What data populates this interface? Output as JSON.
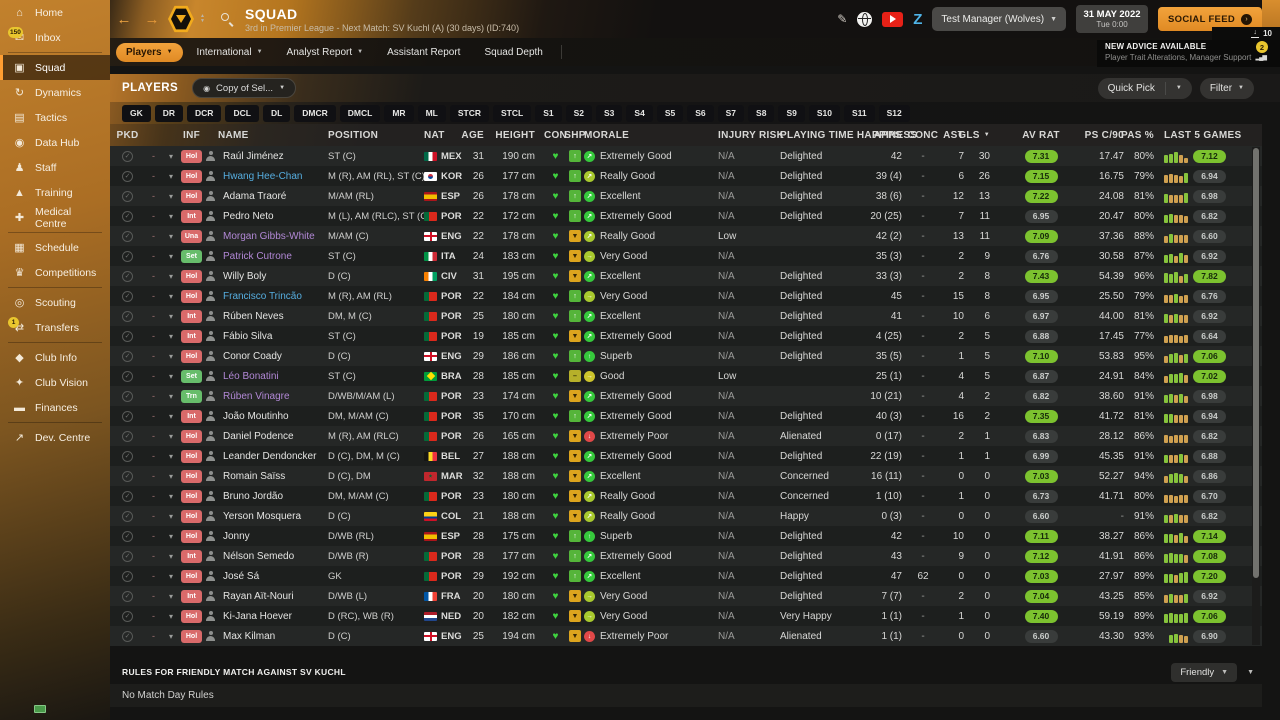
{
  "sidebar": {
    "items": [
      {
        "label": "Home",
        "icon": "home-icon",
        "glyph": "⌂"
      },
      {
        "label": "Inbox",
        "icon": "inbox-icon",
        "glyph": "✉",
        "badge": "150",
        "divider_after": true
      },
      {
        "label": "Squad",
        "icon": "squad-icon",
        "glyph": "▣",
        "active": true
      },
      {
        "label": "Dynamics",
        "icon": "dynamics-icon",
        "glyph": "↻"
      },
      {
        "label": "Tactics",
        "icon": "tactics-icon",
        "glyph": "▤"
      },
      {
        "label": "Data Hub",
        "icon": "data-hub-icon",
        "glyph": "◉"
      },
      {
        "label": "Staff",
        "icon": "staff-icon",
        "glyph": "♟"
      },
      {
        "label": "Training",
        "icon": "training-icon",
        "glyph": "▲"
      },
      {
        "label": "Medical Centre",
        "icon": "medical-centre-icon",
        "glyph": "✚",
        "divider_after": true
      },
      {
        "label": "Schedule",
        "icon": "schedule-icon",
        "glyph": "▦"
      },
      {
        "label": "Competitions",
        "icon": "competitions-icon",
        "glyph": "♛",
        "divider_after": true
      },
      {
        "label": "Scouting",
        "icon": "scouting-icon",
        "glyph": "◎"
      },
      {
        "label": "Transfers",
        "icon": "transfers-icon",
        "glyph": "⇄",
        "badge": "1",
        "divider_after": true
      },
      {
        "label": "Club Info",
        "icon": "club-info-icon",
        "glyph": "◆"
      },
      {
        "label": "Club Vision",
        "icon": "club-vision-icon",
        "glyph": "✦"
      },
      {
        "label": "Finances",
        "icon": "finances-icon",
        "glyph": "▬",
        "divider_after": true
      },
      {
        "label": "Dev. Centre",
        "icon": "dev-centre-icon",
        "glyph": "↗"
      }
    ]
  },
  "topbar": {
    "title": "SQUAD",
    "subtitle": "3rd in Premier League - Next Match: SV Kuchl (A) (30 days) (ID:740)",
    "manager": "Test Manager (Wolves)",
    "date_line1": "31 MAY 2022",
    "date_line2": "Tue 0:00",
    "social_feed": "SOCIAL FEED",
    "downloads": "10"
  },
  "advice": {
    "title": "NEW ADVICE AVAILABLE",
    "subtitle": "Player Trait Alterations, Manager Support",
    "badge": "2"
  },
  "nav": {
    "tabs": [
      {
        "label": "Players",
        "active": true,
        "caret": true
      },
      {
        "label": "International",
        "caret": true
      },
      {
        "label": "Analyst Report",
        "caret": true
      },
      {
        "label": "Assistant Report"
      },
      {
        "label": "Squad Depth"
      }
    ]
  },
  "toolbar": {
    "title": "PLAYERS",
    "view": "Copy of Sel...",
    "quick_pick": "Quick Pick",
    "filter": "Filter"
  },
  "filters": {
    "positions": [
      "GK",
      "DR",
      "DCR",
      "DCL",
      "DL",
      "DMCR",
      "DMCL",
      "MR",
      "ML",
      "STCR",
      "STCL",
      "S1",
      "S2",
      "S3",
      "S4",
      "S5",
      "S6",
      "S7",
      "S8",
      "S9",
      "S10",
      "S11",
      "S12"
    ]
  },
  "table": {
    "columns": [
      "PKD",
      "",
      "",
      "INF",
      "",
      "NAME",
      "POSITION",
      "NAT",
      "AGE",
      "HEIGHT",
      "CON",
      "SHP",
      "MORALE",
      "INJURY RISK",
      "PLAYING TIME HAPPINESS",
      "APPS",
      "CONC",
      "AST",
      "GLS",
      "AV RAT",
      "PS C/90",
      "PAS %",
      "LAST 5 GAMES"
    ],
    "sort_column": "GLS",
    "rows": [
      {
        "inf": "Hol",
        "inf_color": "red",
        "name": "Raúl Jiménez",
        "name_color": "default",
        "pos": "ST (C)",
        "nat": "MEX",
        "age": "31",
        "height": "190 cm",
        "shp": "up",
        "morale": "Extremely Good",
        "injury": "N/A",
        "happiness": "Delighted",
        "apps": "42",
        "conc": "-",
        "ast": "7",
        "gls": "30",
        "av_rat": "7.31",
        "av_good": true,
        "ps_c90": "17.47",
        "pas": "80%",
        "last5_bars": "g8 g9 g11 o8 o5",
        "last5_rat": "7.12",
        "last5_good": true
      },
      {
        "inf": "Hol",
        "inf_color": "red",
        "name": "Hwang Hee-Chan",
        "name_color": "blue",
        "pos": "M (R), AM (RL), ST (C)",
        "nat": "KOR",
        "age": "26",
        "height": "177 cm",
        "shp": "up",
        "morale": "Really Good",
        "injury": "N/A",
        "happiness": "Delighted",
        "apps": "39 (4)",
        "conc": "-",
        "ast": "6",
        "gls": "26",
        "av_rat": "7.15",
        "av_good": true,
        "ps_c90": "16.75",
        "pas": "79%",
        "last5_bars": "o8 o9 o8 o7 g10",
        "last5_rat": "6.94",
        "last5_good": false
      },
      {
        "inf": "Hol",
        "inf_color": "red",
        "name": "Adama Traoré",
        "name_color": "default",
        "pos": "M/AM (RL)",
        "nat": "ESP",
        "age": "26",
        "height": "178 cm",
        "shp": "up",
        "morale": "Excellent",
        "injury": "N/A",
        "happiness": "Delighted",
        "apps": "38 (6)",
        "conc": "-",
        "ast": "12",
        "gls": "13",
        "av_rat": "7.22",
        "av_good": true,
        "ps_c90": "24.08",
        "pas": "81%",
        "last5_bars": "g9 o8 o8 o8 g10",
        "last5_rat": "6.98",
        "last5_good": false
      },
      {
        "inf": "Int",
        "inf_color": "red",
        "name": "Pedro Neto",
        "name_color": "default",
        "pos": "M (L), AM (RLC), ST (C)",
        "nat": "POR",
        "age": "22",
        "height": "172 cm",
        "shp": "up",
        "morale": "Extremely Good",
        "injury": "N/A",
        "happiness": "Delighted",
        "apps": "20 (25)",
        "conc": "-",
        "ast": "7",
        "gls": "11",
        "av_rat": "6.95",
        "av_good": false,
        "ps_c90": "20.47",
        "pas": "80%",
        "last5_bars": "g8 g9 o8 o8 o7",
        "last5_rat": "6.82",
        "last5_good": false
      },
      {
        "inf": "Una",
        "inf_color": "red",
        "name": "Morgan Gibbs-White",
        "name_color": "purple",
        "pos": "M/AM (C)",
        "nat": "ENG",
        "age": "22",
        "height": "178 cm",
        "shp": "down",
        "morale": "Really Good",
        "injury": "Low",
        "happiness": "",
        "apps": "42 (2)",
        "conc": "-",
        "ast": "13",
        "gls": "11",
        "av_rat": "7.09",
        "av_good": true,
        "ps_c90": "37.36",
        "pas": "88%",
        "last5_bars": "o7 g9 o8 o8 o8",
        "last5_rat": "6.60",
        "last5_good": false
      },
      {
        "inf": "Set",
        "inf_color": "green",
        "name": "Patrick Cutrone",
        "name_color": "purple",
        "pos": "ST (C)",
        "nat": "ITA",
        "age": "24",
        "height": "183 cm",
        "shp": "down",
        "morale": "Very Good",
        "injury": "N/A",
        "happiness": "",
        "apps": "35 (3)",
        "conc": "-",
        "ast": "2",
        "gls": "9",
        "av_rat": "6.76",
        "av_good": false,
        "ps_c90": "30.58",
        "pas": "87%",
        "last5_bars": "g8 g9 o7 g10 o8",
        "last5_rat": "6.92",
        "last5_good": false
      },
      {
        "inf": "Hol",
        "inf_color": "red",
        "name": "Willy Boly",
        "name_color": "default",
        "pos": "D (C)",
        "nat": "CIV",
        "age": "31",
        "height": "195 cm",
        "shp": "down",
        "morale": "Excellent",
        "injury": "N/A",
        "happiness": "Delighted",
        "apps": "33 (3)",
        "conc": "-",
        "ast": "2",
        "gls": "8",
        "av_rat": "7.43",
        "av_good": true,
        "ps_c90": "54.39",
        "pas": "96%",
        "last5_bars": "g10 g9 g11 o7 g9",
        "last5_rat": "7.82",
        "last5_good": true
      },
      {
        "inf": "Hol",
        "inf_color": "red",
        "name": "Francisco Trincão",
        "name_color": "blue",
        "pos": "M (R), AM (RL)",
        "nat": "POR",
        "age": "22",
        "height": "184 cm",
        "shp": "up",
        "morale": "Very Good",
        "injury": "N/A",
        "happiness": "Delighted",
        "apps": "45",
        "conc": "-",
        "ast": "15",
        "gls": "8",
        "av_rat": "6.95",
        "av_good": false,
        "ps_c90": "25.50",
        "pas": "79%",
        "last5_bars": "o8 o8 g9 o7 o8",
        "last5_rat": "6.76",
        "last5_good": false
      },
      {
        "inf": "Int",
        "inf_color": "red",
        "name": "Rúben Neves",
        "name_color": "default",
        "pos": "DM, M (C)",
        "nat": "POR",
        "age": "25",
        "height": "180 cm",
        "shp": "up",
        "morale": "Excellent",
        "injury": "N/A",
        "happiness": "Delighted",
        "apps": "41",
        "conc": "-",
        "ast": "10",
        "gls": "6",
        "av_rat": "6.97",
        "av_good": false,
        "ps_c90": "44.00",
        "pas": "81%",
        "last5_bars": "g9 o8 g9 o8 o8",
        "last5_rat": "6.92",
        "last5_good": false
      },
      {
        "inf": "Int",
        "inf_color": "red",
        "name": "Fábio Silva",
        "name_color": "default",
        "pos": "ST (C)",
        "nat": "POR",
        "age": "19",
        "height": "185 cm",
        "shp": "down",
        "morale": "Extremely Good",
        "injury": "N/A",
        "happiness": "Delighted",
        "apps": "4 (25)",
        "conc": "-",
        "ast": "2",
        "gls": "5",
        "av_rat": "6.88",
        "av_good": false,
        "ps_c90": "17.45",
        "pas": "77%",
        "last5_bars": "o7 o8 o8 o7 o8",
        "last5_rat": "6.64",
        "last5_good": false
      },
      {
        "inf": "Hol",
        "inf_color": "red",
        "name": "Conor Coady",
        "name_color": "default",
        "pos": "D (C)",
        "nat": "ENG",
        "age": "29",
        "height": "186 cm",
        "shp": "up",
        "morale": "Superb",
        "injury": "N/A",
        "happiness": "Delighted",
        "apps": "35 (5)",
        "conc": "-",
        "ast": "1",
        "gls": "5",
        "av_rat": "7.10",
        "av_good": true,
        "ps_c90": "53.83",
        "pas": "95%",
        "last5_bars": "o7 g9 g10 o8 g9",
        "last5_rat": "7.06",
        "last5_good": true
      },
      {
        "inf": "Set",
        "inf_color": "green",
        "name": "Léo Bonatini",
        "name_color": "purple",
        "pos": "ST (C)",
        "nat": "BRA",
        "age": "28",
        "height": "185 cm",
        "shp": "flat",
        "morale": "Good",
        "injury": "Low",
        "happiness": "",
        "apps": "25 (1)",
        "conc": "-",
        "ast": "4",
        "gls": "5",
        "av_rat": "6.87",
        "av_good": false,
        "ps_c90": "24.91",
        "pas": "84%",
        "last5_bars": "o7 g9 g9 g10 o8",
        "last5_rat": "7.02",
        "last5_good": true
      },
      {
        "inf": "Trn",
        "inf_color": "green",
        "name": "Rúben Vinagre",
        "name_color": "purple",
        "pos": "D/WB/M/AM (L)",
        "nat": "POR",
        "age": "23",
        "height": "174 cm",
        "shp": "down",
        "morale": "Extremely Good",
        "injury": "N/A",
        "happiness": "",
        "apps": "10 (21)",
        "conc": "-",
        "ast": "4",
        "gls": "2",
        "av_rat": "6.82",
        "av_good": false,
        "ps_c90": "38.60",
        "pas": "91%",
        "last5_bars": "g8 g9 o8 g9 o7",
        "last5_rat": "6.98",
        "last5_good": false
      },
      {
        "inf": "Int",
        "inf_color": "red",
        "name": "João Moutinho",
        "name_color": "default",
        "pos": "DM, M/AM (C)",
        "nat": "POR",
        "age": "35",
        "height": "170 cm",
        "shp": "up",
        "morale": "Extremely Good",
        "injury": "N/A",
        "happiness": "Delighted",
        "apps": "40 (3)",
        "conc": "-",
        "ast": "16",
        "gls": "2",
        "av_rat": "7.35",
        "av_good": true,
        "ps_c90": "41.72",
        "pas": "81%",
        "last5_bars": "g9 g9 o8 o8 o8",
        "last5_rat": "6.94",
        "last5_good": false
      },
      {
        "inf": "Hol",
        "inf_color": "red",
        "name": "Daniel Podence",
        "name_color": "default",
        "pos": "M (R), AM (RLC)",
        "nat": "POR",
        "age": "26",
        "height": "165 cm",
        "shp": "down",
        "morale": "Extremely Poor",
        "injury": "N/A",
        "happiness": "Alienated",
        "apps": "0 (17)",
        "conc": "-",
        "ast": "2",
        "gls": "1",
        "av_rat": "6.83",
        "av_good": false,
        "ps_c90": "28.12",
        "pas": "86%",
        "last5_bars": "o8 o7 o8 o8 o8",
        "last5_rat": "6.82",
        "last5_good": false
      },
      {
        "inf": "Hol",
        "inf_color": "red",
        "name": "Leander Dendoncker",
        "name_color": "default",
        "pos": "D (C), DM, M (C)",
        "nat": "BEL",
        "age": "27",
        "height": "188 cm",
        "shp": "down",
        "morale": "Extremely Good",
        "injury": "N/A",
        "happiness": "Delighted",
        "apps": "22 (19)",
        "conc": "-",
        "ast": "1",
        "gls": "1",
        "av_rat": "6.99",
        "av_good": false,
        "ps_c90": "45.35",
        "pas": "91%",
        "last5_bars": "g8 o8 o8 g9 o8",
        "last5_rat": "6.88",
        "last5_good": false
      },
      {
        "inf": "Hol",
        "inf_color": "red",
        "name": "Romain Saïss",
        "name_color": "default",
        "pos": "D (C), DM",
        "nat": "MAR",
        "age": "32",
        "height": "188 cm",
        "shp": "down",
        "morale": "Excellent",
        "injury": "N/A",
        "happiness": "Concerned",
        "apps": "16 (11)",
        "conc": "-",
        "ast": "0",
        "gls": "0",
        "av_rat": "7.03",
        "av_good": true,
        "ps_c90": "52.27",
        "pas": "94%",
        "last5_bars": "o7 g9 g10 g9 o7",
        "last5_rat": "6.86",
        "last5_good": false
      },
      {
        "inf": "Hol",
        "inf_color": "red",
        "name": "Bruno Jordão",
        "name_color": "default",
        "pos": "DM, M/AM (C)",
        "nat": "POR",
        "age": "23",
        "height": "180 cm",
        "shp": "down",
        "morale": "Really Good",
        "injury": "N/A",
        "happiness": "Concerned",
        "apps": "1 (10)",
        "conc": "-",
        "ast": "1",
        "gls": "0",
        "av_rat": "6.73",
        "av_good": false,
        "ps_c90": "41.71",
        "pas": "80%",
        "last5_bars": "o8 o8 o7 o8 o8",
        "last5_rat": "6.70",
        "last5_good": false
      },
      {
        "inf": "Hol",
        "inf_color": "red",
        "name": "Yerson Mosquera",
        "name_color": "default",
        "pos": "D (C)",
        "nat": "COL",
        "age": "21",
        "height": "188 cm",
        "shp": "down",
        "morale": "Really Good",
        "injury": "N/A",
        "happiness": "Happy",
        "apps": "0 (3)",
        "conc": "-",
        "ast": "0",
        "gls": "0",
        "av_rat": "6.60",
        "av_good": false,
        "ps_c90": "-",
        "pas": "91%",
        "last5_bars": "g8 o8 g9 o8 o8",
        "last5_rat": "6.82",
        "last5_good": false
      },
      {
        "inf": "Hol",
        "inf_color": "red",
        "name": "Jonny",
        "name_color": "default",
        "pos": "D/WB (RL)",
        "nat": "ESP",
        "age": "28",
        "height": "175 cm",
        "shp": "up",
        "morale": "Superb",
        "injury": "N/A",
        "happiness": "Delighted",
        "apps": "42",
        "conc": "-",
        "ast": "10",
        "gls": "0",
        "av_rat": "7.11",
        "av_good": true,
        "ps_c90": "38.27",
        "pas": "86%",
        "last5_bars": "g9 g9 o8 g10 o7",
        "last5_rat": "7.14",
        "last5_good": true
      },
      {
        "inf": "Int",
        "inf_color": "red",
        "name": "Nélson Semedo",
        "name_color": "default",
        "pos": "D/WB (R)",
        "nat": "POR",
        "age": "28",
        "height": "177 cm",
        "shp": "up",
        "morale": "Extremely Good",
        "injury": "N/A",
        "happiness": "Delighted",
        "apps": "43",
        "conc": "-",
        "ast": "9",
        "gls": "0",
        "av_rat": "7.12",
        "av_good": true,
        "ps_c90": "41.91",
        "pas": "86%",
        "last5_bars": "g9 g10 g9 g9 o8",
        "last5_rat": "7.08",
        "last5_good": true
      },
      {
        "inf": "Hol",
        "inf_color": "red",
        "name": "José Sá",
        "name_color": "default",
        "pos": "GK",
        "nat": "POR",
        "age": "29",
        "height": "192 cm",
        "shp": "up",
        "morale": "Excellent",
        "injury": "N/A",
        "happiness": "Delighted",
        "apps": "47",
        "conc": "62",
        "ast": "0",
        "gls": "0",
        "av_rat": "7.03",
        "av_good": true,
        "ps_c90": "27.97",
        "pas": "89%",
        "last5_bars": "g9 g9 o8 g10 g11",
        "last5_rat": "7.20",
        "last5_good": true
      },
      {
        "inf": "Int",
        "inf_color": "red",
        "name": "Rayan Aït-Nouri",
        "name_color": "default",
        "pos": "D/WB (L)",
        "nat": "FRA",
        "age": "20",
        "height": "180 cm",
        "shp": "down",
        "morale": "Very Good",
        "injury": "N/A",
        "happiness": "Delighted",
        "apps": "7 (7)",
        "conc": "-",
        "ast": "2",
        "gls": "0",
        "av_rat": "7.04",
        "av_good": true,
        "ps_c90": "43.25",
        "pas": "85%",
        "last5_bars": "o8 g9 o8 o8 g9",
        "last5_rat": "6.92",
        "last5_good": false
      },
      {
        "inf": "Hol",
        "inf_color": "red",
        "name": "Ki-Jana Hoever",
        "name_color": "default",
        "pos": "D (RC), WB (R)",
        "nat": "NED",
        "age": "20",
        "height": "182 cm",
        "shp": "down",
        "morale": "Very Good",
        "injury": "N/A",
        "happiness": "Very Happy",
        "apps": "1 (1)",
        "conc": "-",
        "ast": "1",
        "gls": "0",
        "av_rat": "7.40",
        "av_good": true,
        "ps_c90": "59.19",
        "pas": "89%",
        "last5_bars": "g9 g10 g9 g9 g10",
        "last5_rat": "7.06",
        "last5_good": true
      },
      {
        "inf": "Hol",
        "inf_color": "red",
        "name": "Max Kilman",
        "name_color": "default",
        "pos": "D (C)",
        "nat": "ENG",
        "age": "25",
        "height": "194 cm",
        "shp": "down",
        "morale": "Extremely Poor",
        "injury": "N/A",
        "happiness": "Alienated",
        "apps": "1 (1)",
        "conc": "-",
        "ast": "0",
        "gls": "0",
        "av_rat": "6.60",
        "av_good": false,
        "ps_c90": "43.30",
        "pas": "93%",
        "last5_bars": "x0 g8 g9 o8 o7",
        "last5_rat": "6.90",
        "last5_good": false
      }
    ]
  },
  "footer": {
    "heading": "RULES FOR FRIENDLY MATCH AGAINST SV KUCHL",
    "rule": "No Match Day Rules",
    "match_type": "Friendly"
  },
  "colors": {
    "accent": "#e8912f",
    "pill_green": "#7cc22f",
    "badge_red": "#d96a6a",
    "badge_green": "#67bd6b",
    "heart_green": "#3fd23f"
  }
}
